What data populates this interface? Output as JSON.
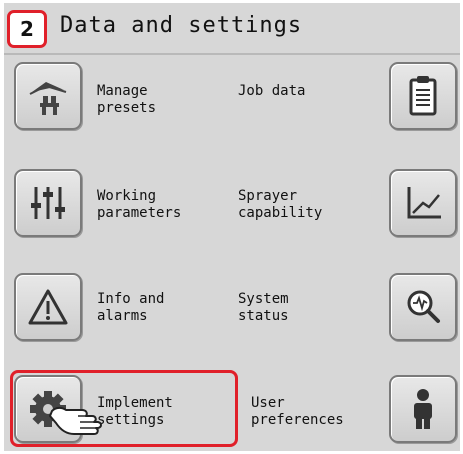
{
  "header": {
    "step_number": "2",
    "title": "Data and settings"
  },
  "menu": {
    "manage_presets": "Manage\npresets",
    "job_data": "Job data",
    "working_parameters": "Working\nparameters",
    "sprayer_capability": "Sprayer\ncapability",
    "info_alarms": "Info and\nalarms",
    "system_status": "System\nstatus",
    "implement_settings": "Implement\nsettings",
    "user_preferences": "User\npreferences"
  },
  "icons": {
    "manage_presets": "presets-icon",
    "job_data": "clipboard-icon",
    "working_parameters": "sliders-icon",
    "sprayer_capability": "chart-icon",
    "info_alarms": "warning-icon",
    "system_status": "magnifier-icon",
    "implement_settings": "gear-icon",
    "user_preferences": "person-icon",
    "pointer": "hand-pointer-icon"
  },
  "colors": {
    "highlight": "#e0202a",
    "background": "#d7d7d7"
  }
}
